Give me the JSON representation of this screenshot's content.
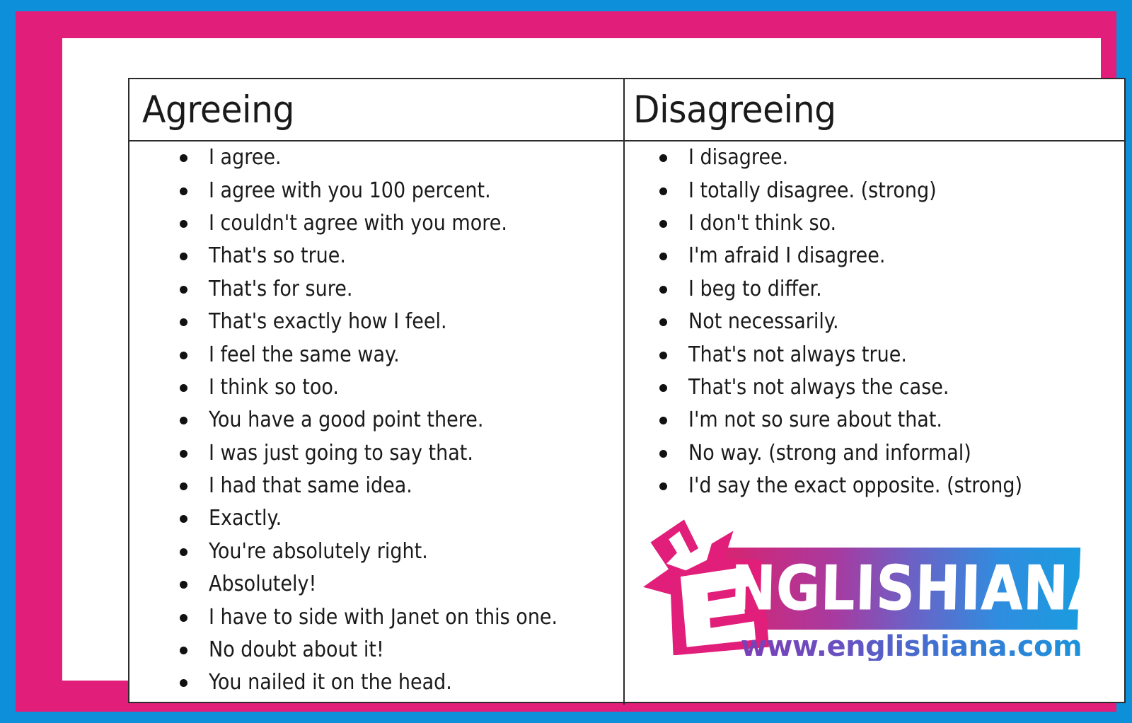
{
  "frame": {
    "outer_color": "#0d8fd9",
    "inner_color": "#e11e79",
    "card_color": "#ffffff"
  },
  "table": {
    "columns": [
      {
        "id": "agreeing",
        "header": "Agreeing",
        "items": [
          "I agree.",
          "I agree with you 100 percent.",
          "I couldn't agree with you more.",
          "That's so true.",
          "That's for sure.",
          "That's exactly how I feel.",
          "I feel the same way.",
          "I think so too.",
          "You have a good point there.",
          "I was just going to say that.",
          "I had that same idea.",
          "Exactly.",
          "You're absolutely right.",
          "Absolutely!",
          "I have to side with Janet on this one.",
          "No doubt about it!",
          "You nailed it on the head."
        ]
      },
      {
        "id": "disagreeing",
        "header": "Disagreeing",
        "items": [
          "I disagree.",
          "I totally disagree. (strong)",
          "I don't think so.",
          "I'm afraid I disagree.",
          "I beg to differ.",
          "Not necessarily.",
          "That's not always true.",
          "That's not always the case.",
          "I'm not so sure about that.",
          "No way. (strong and informal)",
          "I'd say the exact opposite. (strong)"
        ]
      }
    ]
  },
  "logo": {
    "mark_letter": "E",
    "wordmark": "NGLISHIANA",
    "url": "www.englishiana.com",
    "mark_color": "#e11e79",
    "gradient_start": "#d8246f",
    "gradient_end": "#1b9bdf",
    "url_color_start": "#7b3fb5",
    "url_color_end": "#1b93dd"
  }
}
